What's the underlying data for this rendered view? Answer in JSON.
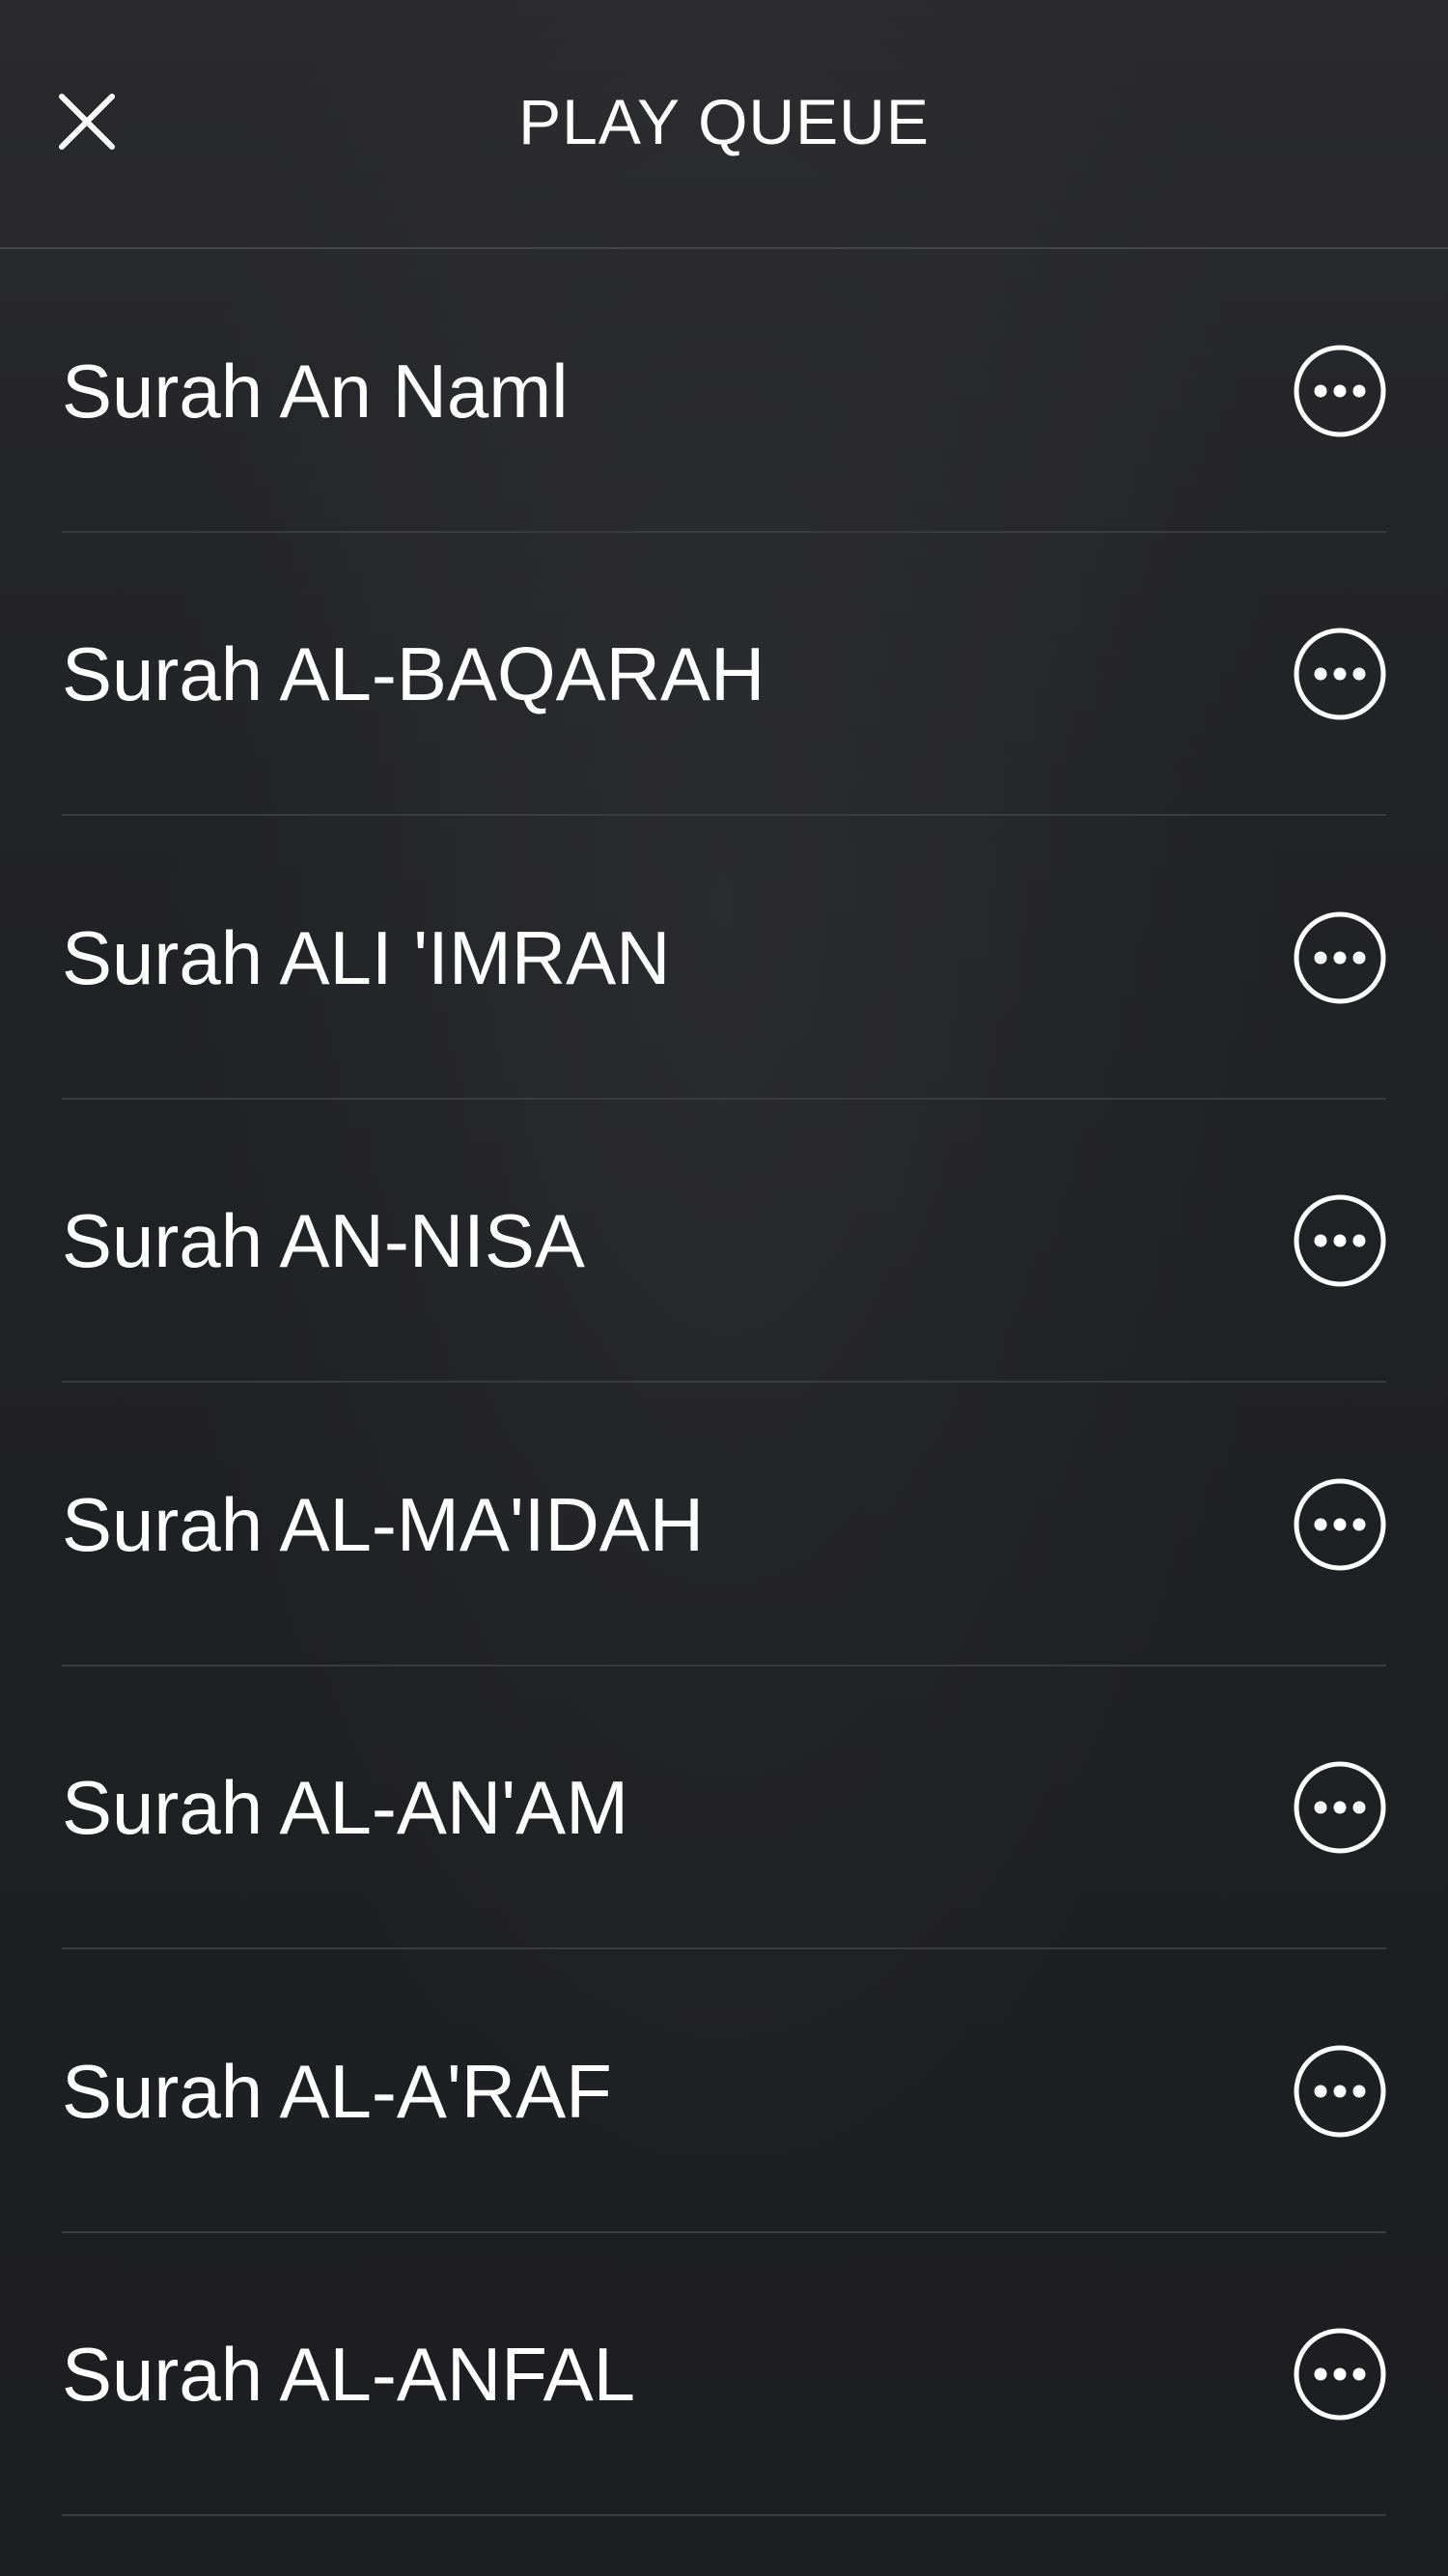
{
  "header": {
    "title": "PLAY QUEUE",
    "close_icon": "close-icon"
  },
  "queue": {
    "items": [
      {
        "title": "Surah An Naml",
        "menu_icon": "more-options-icon"
      },
      {
        "title": "Surah AL-BAQARAH",
        "menu_icon": "more-options-icon"
      },
      {
        "title": "Surah ALI 'IMRAN",
        "menu_icon": "more-options-icon"
      },
      {
        "title": "Surah AN-NISA",
        "menu_icon": "more-options-icon"
      },
      {
        "title": "Surah AL-MA'IDAH",
        "menu_icon": "more-options-icon"
      },
      {
        "title": "Surah AL-AN'AM",
        "menu_icon": "more-options-icon"
      },
      {
        "title": "Surah AL-A'RAF",
        "menu_icon": "more-options-icon"
      },
      {
        "title": "Surah AL-ANFAL",
        "menu_icon": "more-options-icon"
      }
    ]
  },
  "colors": {
    "background": "#1f2023",
    "text": "#ffffff",
    "divider": "#3a3b3f"
  }
}
